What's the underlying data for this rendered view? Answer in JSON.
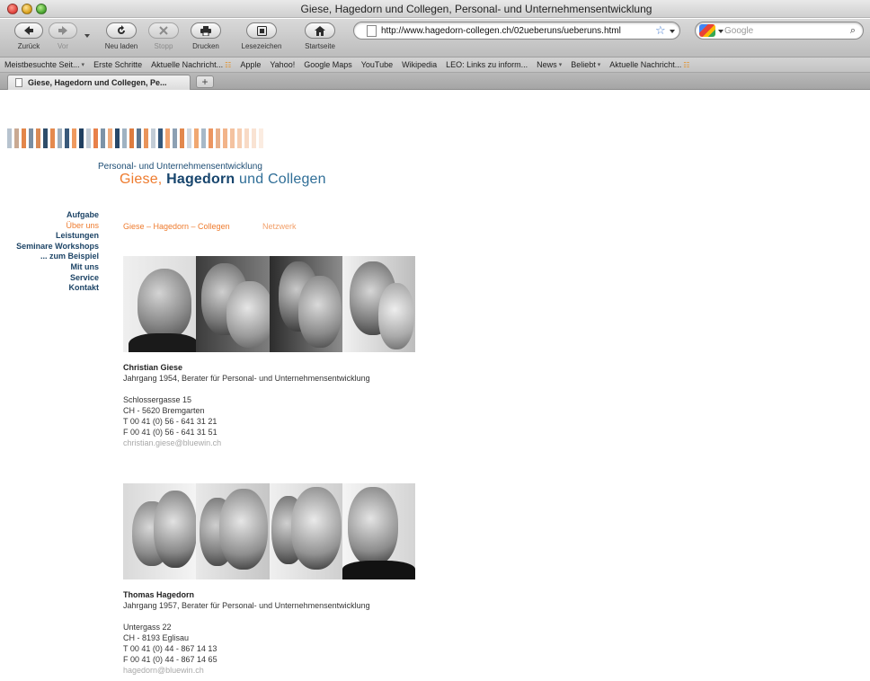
{
  "window": {
    "title": "Giese, Hagedorn und Collegen, Personal- und Unternehmensentwicklung"
  },
  "toolbar": {
    "back": "Zurück",
    "forward": "Vor",
    "reload": "Neu laden",
    "stop": "Stopp",
    "print": "Drucken",
    "bookmarks": "Lesezeichen",
    "home": "Startseite",
    "url": "http://www.hagedorn-collegen.ch/02ueberuns/ueberuns.html",
    "search_placeholder": "Google"
  },
  "bookmarks_bar": [
    {
      "label": "Meistbesuchte Seit...",
      "suffix": "chevron"
    },
    {
      "label": "Erste Schritte",
      "suffix": ""
    },
    {
      "label": "Aktuelle Nachricht...",
      "suffix": "rss"
    },
    {
      "label": "Apple",
      "suffix": ""
    },
    {
      "label": "Yahoo!",
      "suffix": ""
    },
    {
      "label": "Google Maps",
      "suffix": ""
    },
    {
      "label": "YouTube",
      "suffix": ""
    },
    {
      "label": "Wikipedia",
      "suffix": ""
    },
    {
      "label": "LEO: Links zu inform...",
      "suffix": ""
    },
    {
      "label": "News",
      "suffix": "chevron"
    },
    {
      "label": "Beliebt",
      "suffix": "chevron"
    },
    {
      "label": "Aktuelle Nachricht...",
      "suffix": "rss"
    }
  ],
  "tab": {
    "title": "Giese, Hagedorn und Collegen, Pe...",
    "new_tab": "+"
  },
  "site": {
    "subtitle": "Personal- und Unternehmensentwicklung",
    "brand_giese": "Giese,",
    "brand_hagedorn": "Hagedorn",
    "brand_rest": "und Collegen",
    "accent_color": "#ee7b2e",
    "navy_color": "#17456d"
  },
  "sidenav": [
    {
      "label": "Aufgabe",
      "active": false
    },
    {
      "label": "Über uns",
      "active": true
    },
    {
      "label": "Leistungen",
      "active": false
    },
    {
      "label": "Seminare Workshops",
      "active": false
    },
    {
      "label": "... zum Beispiel",
      "active": false
    },
    {
      "label": "Mit uns",
      "active": false
    },
    {
      "label": "Service",
      "active": false
    },
    {
      "label": "Kontakt",
      "active": false
    }
  ],
  "subnav": {
    "first": "Giese – Hagedorn – Collegen",
    "second": "Netzwerk"
  },
  "people": [
    {
      "name": "Christian Giese",
      "role": "Jahrgang 1954, Berater für Personal- und Unternehmensentwicklung",
      "street": "Schlossergasse 15",
      "city": "CH - 5620 Bremgarten",
      "tel": "T  00 41 (0) 56 - 641 31 21",
      "fax": "F  00 41 (0) 56 - 641 31 51",
      "email": "christian.giese@bluewin.ch"
    },
    {
      "name": "Thomas Hagedorn",
      "role": "Jahrgang 1957, Berater für Personal- und Unternehmensentwicklung",
      "street": "Untergass 22",
      "city": "CH - 8193 Eglisau",
      "tel": "T  00 41 (0) 44 - 867 14 13",
      "fax": "F  00 41 (0) 44 - 867 14 65",
      "email": "hagedorn@bluewin.ch"
    }
  ]
}
